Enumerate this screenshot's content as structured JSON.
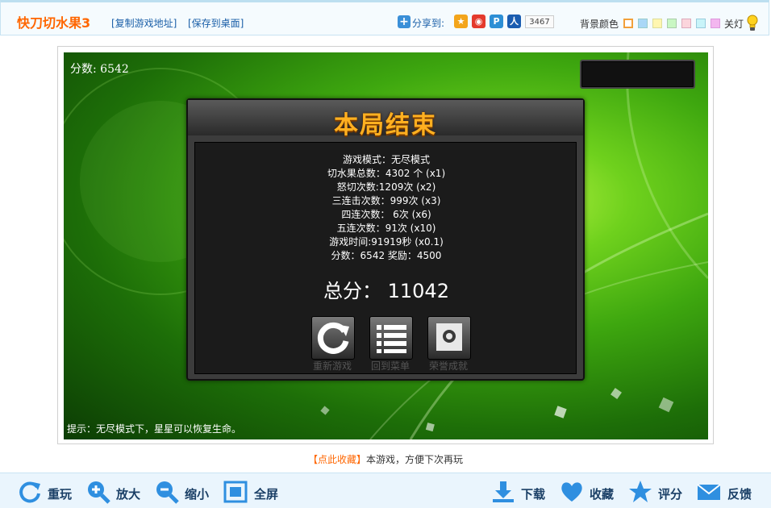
{
  "header": {
    "game_title": "快刀切水果3",
    "copy_link": "[复制游戏地址]",
    "save_desktop": "[保存到桌面]",
    "share_label": "分享到:",
    "share_count": "3467",
    "share_icons": [
      "qzone-icon",
      "weibo-icon",
      "pengyou-icon",
      "renren-icon"
    ],
    "bg_label": "背景颜色",
    "swatches": [
      "#ffffff",
      "#aad7f7",
      "#fff6b0",
      "#c9f7c3",
      "#fbd5dc",
      "#c8f4f9",
      "#f3b6ef"
    ],
    "lights_label": "关灯"
  },
  "game": {
    "score_text": "分数: 6542",
    "hint": "提示：无尽模式下，星星可以恢复生命。",
    "panel": {
      "title": "本局结束",
      "stats": [
        "游戏模式：无尽模式",
        "切水果总数：4302 个  (x1)",
        "怒切次数:1209次  (x2)",
        "三连击次数：999次  (x3)",
        "四连次数：  6次  (x6)",
        "五连次数：91次  (x10)",
        "游戏时间:91919秒  (x0.1)",
        "分数：6542     奖励：4500"
      ],
      "total": "总分：  11042",
      "buttons": {
        "restart": "重新游戏",
        "menu": "回到菜单",
        "achievements": "荣誉成就"
      }
    }
  },
  "bottom_note": {
    "fav": "【点此收藏】",
    "rest": "本游戏，方便下次再玩"
  },
  "toolbar": {
    "replay": "重玩",
    "zoom_in": "放大",
    "zoom_out": "缩小",
    "fullscreen": "全屏",
    "download": "下载",
    "favorite": "收藏",
    "rate": "评分",
    "feedback": "反馈"
  },
  "colors": {
    "accent_orange": "#ff6600",
    "link_blue": "#1a5fa8",
    "toolbar_bg": "#eaf5fd",
    "icon_blue": "#2f8fe0"
  }
}
